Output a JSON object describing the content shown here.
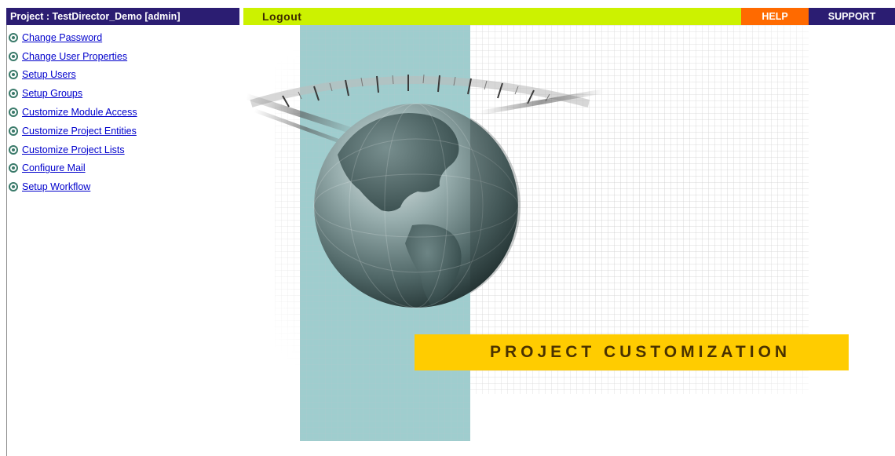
{
  "header": {
    "project_title": "Project : TestDirector_Demo [admin]",
    "logout_label": "Logout",
    "help_label": "HELP",
    "support_label": "SUPPORT"
  },
  "sidebar": {
    "items": [
      {
        "label": "Change Password"
      },
      {
        "label": "Change User Properties"
      },
      {
        "label": "Setup Users"
      },
      {
        "label": "Setup Groups"
      },
      {
        "label": "Customize Module Access"
      },
      {
        "label": "Customize Project Entities"
      },
      {
        "label": "Customize Project Lists"
      },
      {
        "label": "Configure Mail"
      },
      {
        "label": "Setup Workflow"
      }
    ]
  },
  "hero": {
    "banner_text": "PROJECT CUSTOMIZATION"
  },
  "colors": {
    "header_navy": "#2b1d72",
    "logout_bar_lime": "#ccf200",
    "help_orange": "#ff6a00",
    "banner_yellow": "#ffcc00",
    "teal_band": "#9fcdce",
    "link_blue": "#0000cc"
  },
  "icons": {
    "menu_bullet": "radio-bullet-icon",
    "hero_image": "globe-image"
  }
}
